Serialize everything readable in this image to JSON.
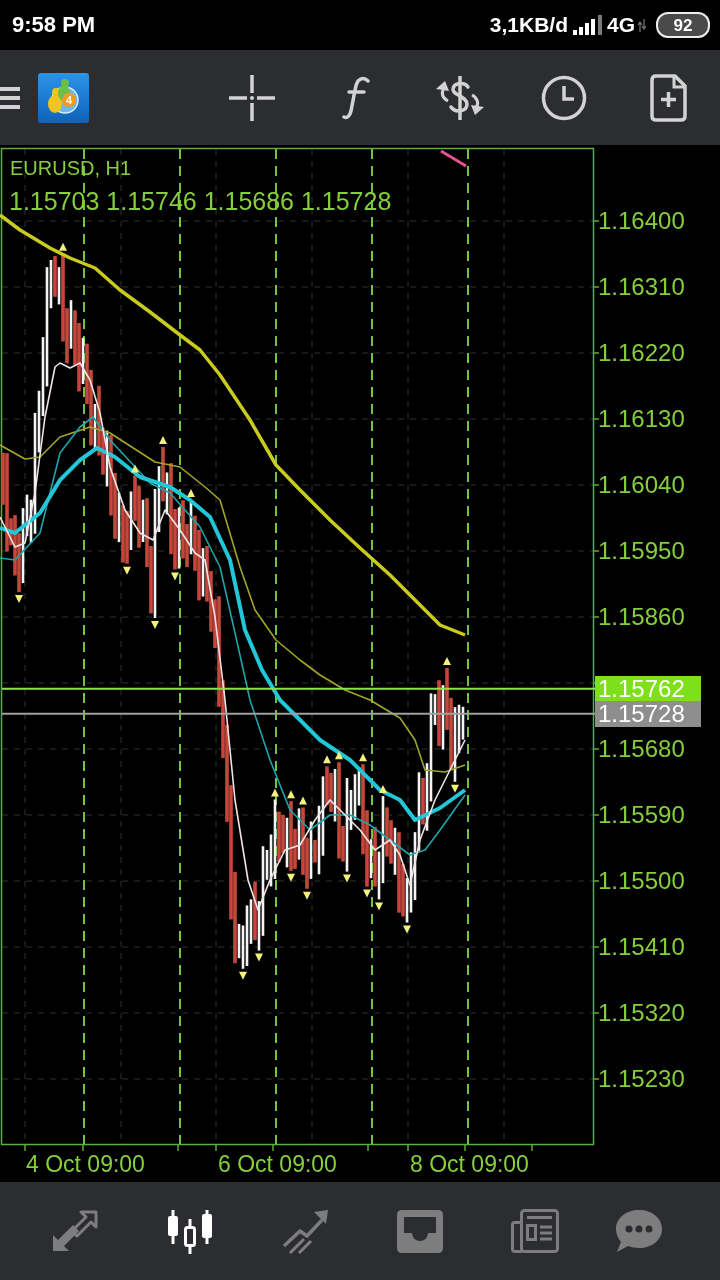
{
  "status_bar": {
    "time": "9:58 PM",
    "network_speed": "3,1KB/d",
    "network_type": "4G",
    "battery": "92"
  },
  "toolbar": {
    "logo_badge": "4"
  },
  "chart": {
    "symbol": "EURUSD, H1",
    "ohlc": "1.15703 1.15746 1.15686 1.15728",
    "price_labels": [
      "1.16400",
      "1.16310",
      "1.16220",
      "1.16130",
      "1.16040",
      "1.15950",
      "1.15860",
      "1.15680",
      "1.15590",
      "1.15500",
      "1.15410",
      "1.15320",
      "1.15230"
    ],
    "ask_tag": "1.15762",
    "bid_tag": "1.15728",
    "time_labels": [
      "4 Oct 09:00",
      "6 Oct 09:00",
      "8 Oct 09:00"
    ]
  },
  "bottom_nav": [
    {
      "kind": "arrows",
      "selected": false
    },
    {
      "kind": "candles",
      "selected": true
    },
    {
      "kind": "trend",
      "selected": false
    },
    {
      "kind": "tray",
      "selected": false
    },
    {
      "kind": "newspaper",
      "selected": false
    },
    {
      "kind": "chat",
      "selected": false
    }
  ]
}
